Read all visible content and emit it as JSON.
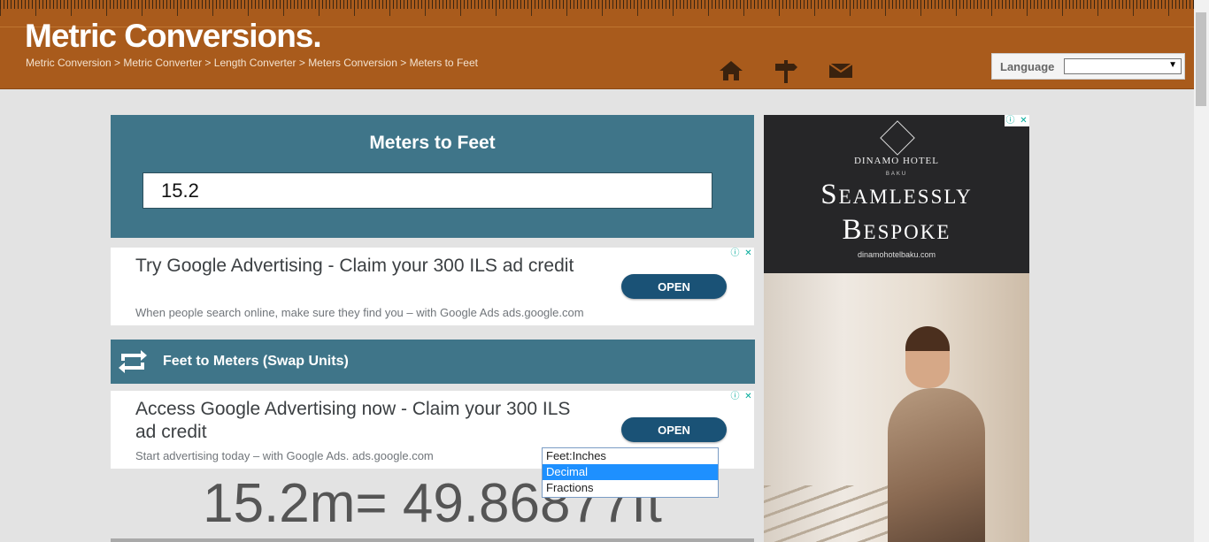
{
  "header": {
    "logo": "Metric Conversions.",
    "breadcrumb": [
      "Metric Conversion",
      "Metric Converter",
      "Length Converter",
      "Meters Conversion",
      "Meters to Feet"
    ],
    "breadcrumb_separator": " > ",
    "nav_icons": [
      "home-icon",
      "signpost-icon",
      "mail-icon"
    ],
    "language": {
      "label": "Language",
      "value": ""
    }
  },
  "converter": {
    "title": "Meters to Feet",
    "input_value": "15.2"
  },
  "ads": [
    {
      "headline": "Try Google Advertising - Claim your 300 ILS ad credit",
      "description": "When people search online, make sure they find you – with Google Ads ads.google.com",
      "button": "OPEN"
    },
    {
      "headline": "Access Google Advertising now - Claim your 300 ILS ad credit",
      "description": "Start advertising today – with Google Ads. ads.google.com",
      "button": "OPEN"
    }
  ],
  "ad_badges": {
    "info": "ⓘ",
    "close": "✕"
  },
  "swap": {
    "label": "Feet to Meters (Swap Units)"
  },
  "result": {
    "text": "15.2m= 49.86877ft"
  },
  "format_dropdown": {
    "options": [
      "Feet:Inches",
      "Decimal",
      "Fractions"
    ],
    "selected": "Decimal"
  },
  "side_ad": {
    "brand": "DINAMO HOTEL",
    "brand_sub": "BAKU",
    "headline_line1": "Seamlessly",
    "headline_line2": "Bespoke",
    "url": "dinamohotelbaku.com"
  },
  "colors": {
    "header_bg": "#a95b1c",
    "panel_bg": "#3f7589",
    "ad_button": "#1a5276",
    "page_bg": "#e3e3e3"
  }
}
